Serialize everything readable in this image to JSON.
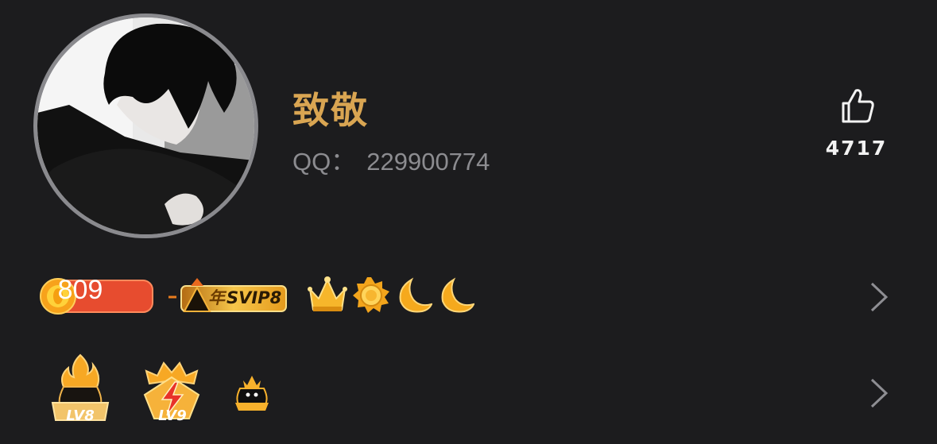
{
  "profile": {
    "name": "致敬",
    "qq_label": "QQ：",
    "qq_number": "229900774"
  },
  "like": {
    "icon": "thumbs-up-icon",
    "count": "4717"
  },
  "badges_row1": {
    "coin_count": "809",
    "svip_year": "年",
    "svip_label": "SVIP8",
    "icons": [
      "crown-icon",
      "sun-icon",
      "moon-icon",
      "moon-icon"
    ]
  },
  "badges_row2": {
    "levels": [
      {
        "icon": "flame-level-icon",
        "label": "LV8"
      },
      {
        "icon": "lightning-level-icon",
        "label": "LV9"
      }
    ],
    "extra_icon": "qq-penguin-crown-icon"
  },
  "colors": {
    "background": "#1c1c1e",
    "name": "#d9a552",
    "qq": "#8c8c90",
    "gold": "#f2b021",
    "coin_badge": "#e74c2f"
  }
}
